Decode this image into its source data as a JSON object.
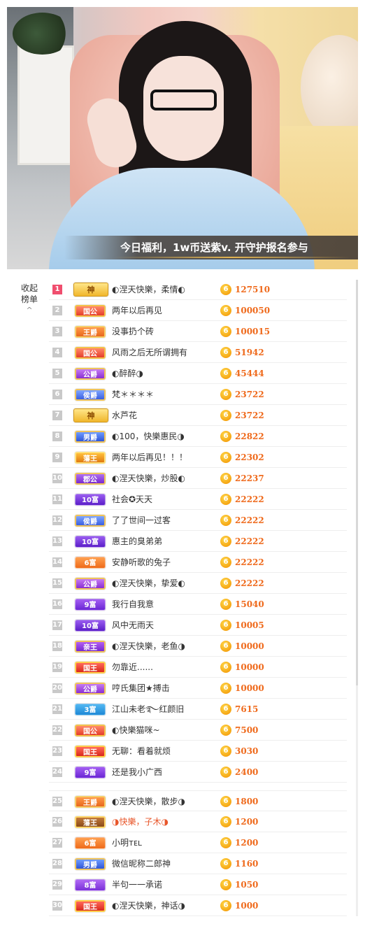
{
  "video": {
    "banner_text": "今日福利，1w币送紫v. 开守护报名参与"
  },
  "sidebar": {
    "collapse_label": "收起",
    "board_label": "榜单",
    "chevron": "^"
  },
  "leaderboard": {
    "coin_glyph": "6",
    "rows": [
      {
        "rank": "1",
        "badge": "神",
        "badge_style": "shen",
        "name": "◐涅天快樂，柔情◐",
        "score": "127510"
      },
      {
        "rank": "2",
        "badge": "国公",
        "badge_style": "guogong",
        "name": "两年以后再见",
        "score": "100050"
      },
      {
        "rank": "3",
        "badge": "王爵",
        "badge_style": "wangjue",
        "name": "没事扔个砖",
        "score": "100015"
      },
      {
        "rank": "4",
        "badge": "国公",
        "badge_style": "guogong",
        "name": "风雨之后无所谓拥有",
        "score": "51942"
      },
      {
        "rank": "5",
        "badge": "公爵",
        "badge_style": "gonggong",
        "name": "◐醉醉◑",
        "score": "45444"
      },
      {
        "rank": "6",
        "badge": "侯爵",
        "badge_style": "houjue",
        "name": "梵＊＊＊＊",
        "score": "23722"
      },
      {
        "rank": "7",
        "badge": "神",
        "badge_style": "shen",
        "name": "水芦花",
        "score": "23722"
      },
      {
        "rank": "8",
        "badge": "男爵",
        "badge_style": "nanjue",
        "name": "◐100，快樂惠民◑",
        "score": "22822"
      },
      {
        "rank": "9",
        "badge": "藩王",
        "badge_style": "fanwang",
        "name": "两年以后再见！！！",
        "score": "22302"
      },
      {
        "rank": "10",
        "badge": "郡公",
        "badge_style": "jungong",
        "name": "◐涅天快樂，炒股◐",
        "score": "22237"
      },
      {
        "rank": "11",
        "badge": "10富",
        "badge_style": "fu10",
        "name": "社会✪天天",
        "score": "22222"
      },
      {
        "rank": "12",
        "badge": "侯爵",
        "badge_style": "houjue",
        "name": "了了世间一过客",
        "score": "22222"
      },
      {
        "rank": "13",
        "badge": "10富",
        "badge_style": "fu10",
        "name": "惠主的臭弟弟",
        "score": "22222"
      },
      {
        "rank": "14",
        "badge": "6富",
        "badge_style": "fu6",
        "name": "安静听歌的兔子",
        "score": "22222"
      },
      {
        "rank": "15",
        "badge": "公爵",
        "badge_style": "gonggong",
        "name": "◐涅天快樂，挚爱◐",
        "score": "22222"
      },
      {
        "rank": "16",
        "badge": "9富",
        "badge_style": "fu9",
        "name": "我行自我意",
        "score": "15040"
      },
      {
        "rank": "17",
        "badge": "10富",
        "badge_style": "fu10",
        "name": "风中无雨天",
        "score": "10005"
      },
      {
        "rank": "18",
        "badge": "亲王",
        "badge_style": "qinwang",
        "name": "◐涅天快樂，老鱼◑",
        "score": "10000"
      },
      {
        "rank": "19",
        "badge": "国王",
        "badge_style": "guowang",
        "name": "勿靠近......",
        "score": "10000"
      },
      {
        "rank": "20",
        "badge": "公爵",
        "badge_style": "gonggong",
        "name": "哼氏集团★搏击",
        "score": "10000"
      },
      {
        "rank": "21",
        "badge": "3富",
        "badge_style": "fu3",
        "name": "江山未老࿐红颜旧",
        "score": "7615"
      },
      {
        "rank": "22",
        "badge": "国公",
        "badge_style": "guogong",
        "name": "◐快樂猫咪~",
        "score": "7500"
      },
      {
        "rank": "23",
        "badge": "国王",
        "badge_style": "guowang",
        "name": "无聊：看着就烦",
        "score": "3030"
      },
      {
        "rank": "24",
        "badge": "9富",
        "badge_style": "fu9",
        "name": "还是我小广西",
        "score": "2400"
      },
      {
        "rank": "25",
        "badge": "王爵",
        "badge_style": "wangjue",
        "name": "◐涅天快樂，散步◑",
        "score": "1800"
      },
      {
        "rank": "26",
        "badge": "藩王",
        "badge_style": "fanwang2",
        "name": "◑快樂，子木◑",
        "score": "1200",
        "name_color": "red"
      },
      {
        "rank": "27",
        "badge": "6富",
        "badge_style": "fu6",
        "name": "小明ᴛᴇʟ",
        "score": "1200"
      },
      {
        "rank": "28",
        "badge": "男爵",
        "badge_style": "nanjue",
        "name": "微信昵称二郎神",
        "score": "1160"
      },
      {
        "rank": "29",
        "badge": "8富",
        "badge_style": "fu8",
        "name": "半句一一承诺",
        "score": "1050"
      },
      {
        "rank": "30",
        "badge": "国王",
        "badge_style": "guowang",
        "name": "◐涅天快樂，神话◑",
        "score": "1000"
      }
    ]
  }
}
